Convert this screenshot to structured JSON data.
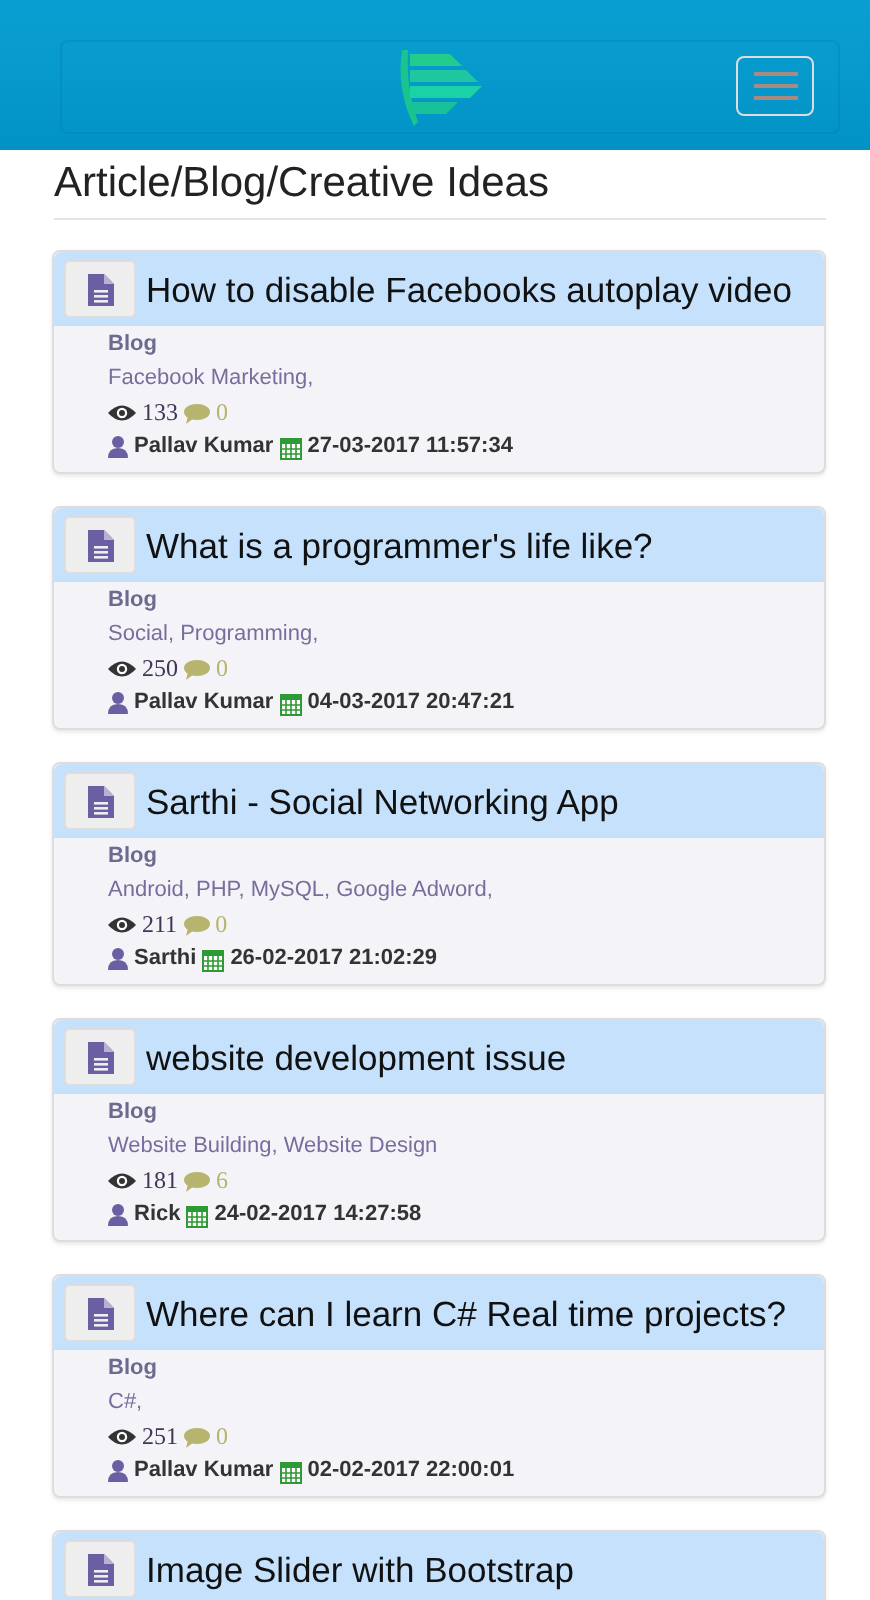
{
  "page_title": "Article/Blog/Creative Ideas",
  "posts": [
    {
      "title": "How to disable Facebooks autoplay video",
      "category": "Blog",
      "tags": "Facebook Marketing,",
      "views": "133",
      "comments": "0",
      "author": "Pallav Kumar",
      "date": "27-03-2017 11:57:34"
    },
    {
      "title": "What is a programmer's life like?",
      "category": "Blog",
      "tags": "Social, Programming,",
      "views": "250",
      "comments": "0",
      "author": "Pallav Kumar",
      "date": "04-03-2017 20:47:21"
    },
    {
      "title": "Sarthi - Social Networking App",
      "category": "Blog",
      "tags": "Android, PHP, MySQL, Google Adword,",
      "views": "211",
      "comments": "0",
      "author": "Sarthi",
      "date": "26-02-2017 21:02:29"
    },
    {
      "title": "website development issue",
      "category": "Blog",
      "tags": "Website Building, Website Design",
      "views": "181",
      "comments": "6",
      "author": "Rick",
      "date": "24-02-2017 14:27:58"
    },
    {
      "title": "Where can I learn C# Real time projects?",
      "category": "Blog",
      "tags": "C#,",
      "views": "251",
      "comments": "0",
      "author": "Pallav Kumar",
      "date": "02-02-2017 22:00:01"
    },
    {
      "title": "Image Slider with Bootstrap"
    }
  ]
}
